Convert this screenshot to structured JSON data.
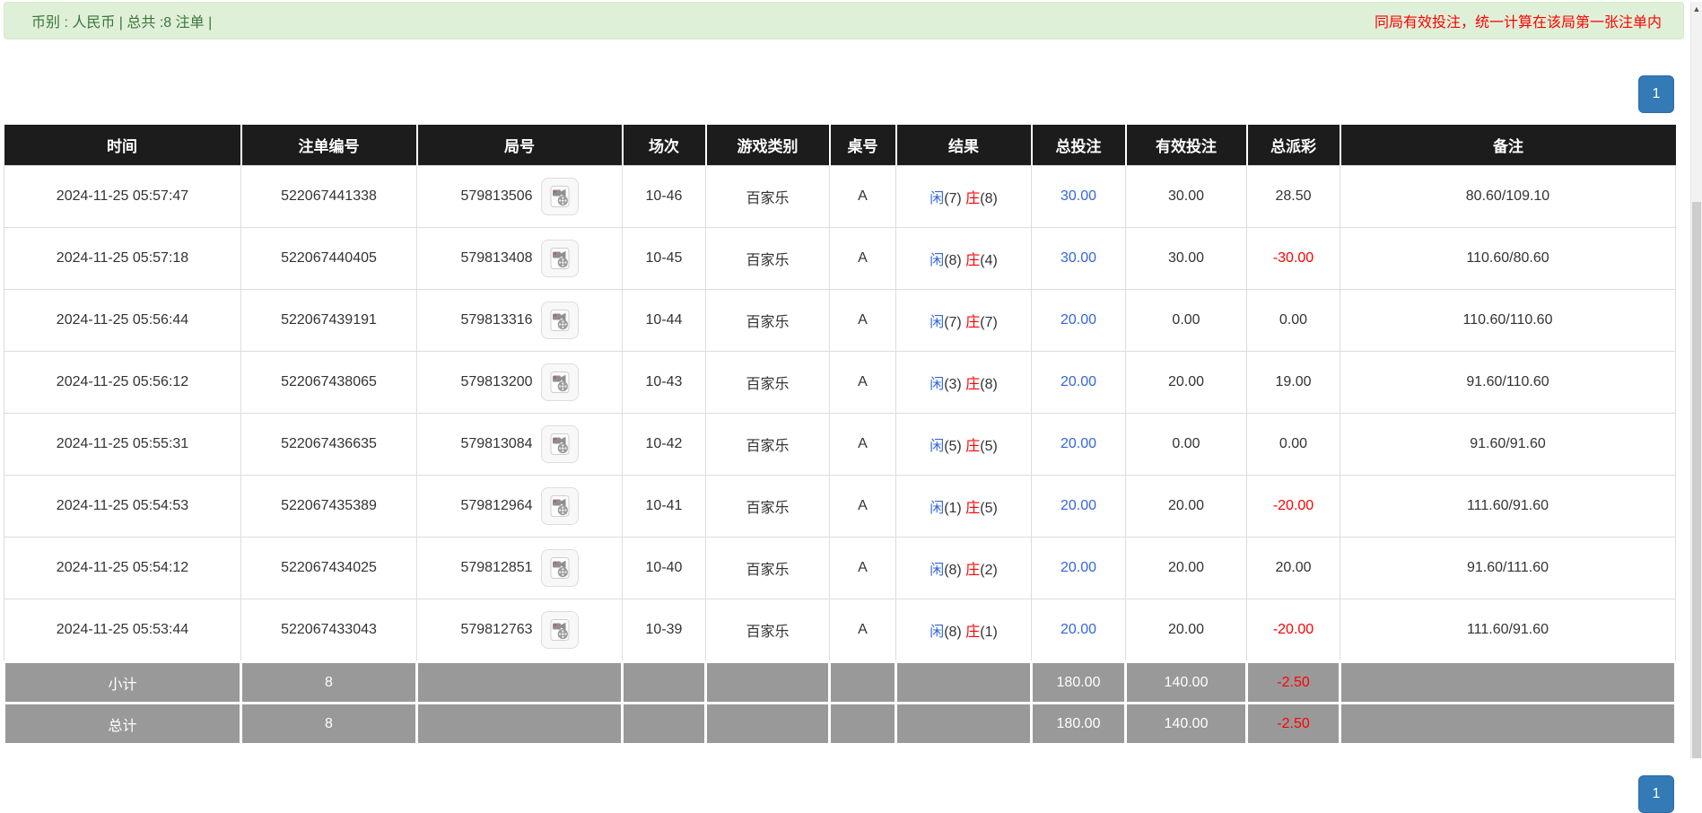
{
  "top_bar": {
    "info": "币别 : 人民币 | 总共 :8 注单 |",
    "notice": "同局有效投注，统一计算在该局第一张注单内"
  },
  "pagination": {
    "current": "1"
  },
  "colors": {
    "alert_bg": "#dff0d8",
    "alert_text": "#3c763d",
    "notice_red": "#ff0000",
    "header_bg": "#1c1c1c",
    "link_blue": "#3366dd",
    "negative_red": "#ff0000",
    "summary_gray": "#999999",
    "primary_button": "#337ab7"
  },
  "icons": {
    "round_video": "video-camera-icon",
    "scrollbar_up": "up-arrow-icon"
  },
  "table": {
    "headers": [
      "时间",
      "注单编号",
      "局号",
      "场次",
      "游戏类别",
      "桌号",
      "结果",
      "总投注",
      "有效投注",
      "总派彩",
      "备注"
    ],
    "rows": [
      {
        "time": "2024-11-25 05:57:47",
        "bet_id": "522067441338",
        "round_id": "579813506",
        "session": "10-46",
        "game": "百家乐",
        "table_no": "A",
        "result": {
          "player": "闲",
          "player_score": "(7)",
          "banker": "庄",
          "banker_score": "(8)"
        },
        "total_bet": "30.00",
        "valid_bet": "30.00",
        "payout": "28.50",
        "remark": "80.60/109.10"
      },
      {
        "time": "2024-11-25 05:57:18",
        "bet_id": "522067440405",
        "round_id": "579813408",
        "session": "10-45",
        "game": "百家乐",
        "table_no": "A",
        "result": {
          "player": "闲",
          "player_score": "(8)",
          "banker": "庄",
          "banker_score": "(4)"
        },
        "total_bet": "30.00",
        "valid_bet": "30.00",
        "payout": "-30.00",
        "remark": "110.60/80.60"
      },
      {
        "time": "2024-11-25 05:56:44",
        "bet_id": "522067439191",
        "round_id": "579813316",
        "session": "10-44",
        "game": "百家乐",
        "table_no": "A",
        "result": {
          "player": "闲",
          "player_score": "(7)",
          "banker": "庄",
          "banker_score": "(7)"
        },
        "total_bet": "20.00",
        "valid_bet": "0.00",
        "payout": "0.00",
        "remark": "110.60/110.60"
      },
      {
        "time": "2024-11-25 05:56:12",
        "bet_id": "522067438065",
        "round_id": "579813200",
        "session": "10-43",
        "game": "百家乐",
        "table_no": "A",
        "result": {
          "player": "闲",
          "player_score": "(3)",
          "banker": "庄",
          "banker_score": "(8)"
        },
        "total_bet": "20.00",
        "valid_bet": "20.00",
        "payout": "19.00",
        "remark": "91.60/110.60"
      },
      {
        "time": "2024-11-25 05:55:31",
        "bet_id": "522067436635",
        "round_id": "579813084",
        "session": "10-42",
        "game": "百家乐",
        "table_no": "A",
        "result": {
          "player": "闲",
          "player_score": "(5)",
          "banker": "庄",
          "banker_score": "(5)"
        },
        "total_bet": "20.00",
        "valid_bet": "0.00",
        "payout": "0.00",
        "remark": "91.60/91.60"
      },
      {
        "time": "2024-11-25 05:54:53",
        "bet_id": "522067435389",
        "round_id": "579812964",
        "session": "10-41",
        "game": "百家乐",
        "table_no": "A",
        "result": {
          "player": "闲",
          "player_score": "(1)",
          "banker": "庄",
          "banker_score": "(5)"
        },
        "total_bet": "20.00",
        "valid_bet": "20.00",
        "payout": "-20.00",
        "remark": "111.60/91.60"
      },
      {
        "time": "2024-11-25 05:54:12",
        "bet_id": "522067434025",
        "round_id": "579812851",
        "session": "10-40",
        "game": "百家乐",
        "table_no": "A",
        "result": {
          "player": "闲",
          "player_score": "(8)",
          "banker": "庄",
          "banker_score": "(2)"
        },
        "total_bet": "20.00",
        "valid_bet": "20.00",
        "payout": "20.00",
        "remark": "91.60/111.60"
      },
      {
        "time": "2024-11-25 05:53:44",
        "bet_id": "522067433043",
        "round_id": "579812763",
        "session": "10-39",
        "game": "百家乐",
        "table_no": "A",
        "result": {
          "player": "闲",
          "player_score": "(8)",
          "banker": "庄",
          "banker_score": "(1)"
        },
        "total_bet": "20.00",
        "valid_bet": "20.00",
        "payout": "-20.00",
        "remark": "111.60/91.60"
      }
    ],
    "subtotal": {
      "label": "小计",
      "count": "8",
      "total_bet": "180.00",
      "valid_bet": "140.00",
      "payout": "-2.50"
    },
    "total": {
      "label": "总计",
      "count": "8",
      "total_bet": "180.00",
      "valid_bet": "140.00",
      "payout": "-2.50"
    }
  }
}
